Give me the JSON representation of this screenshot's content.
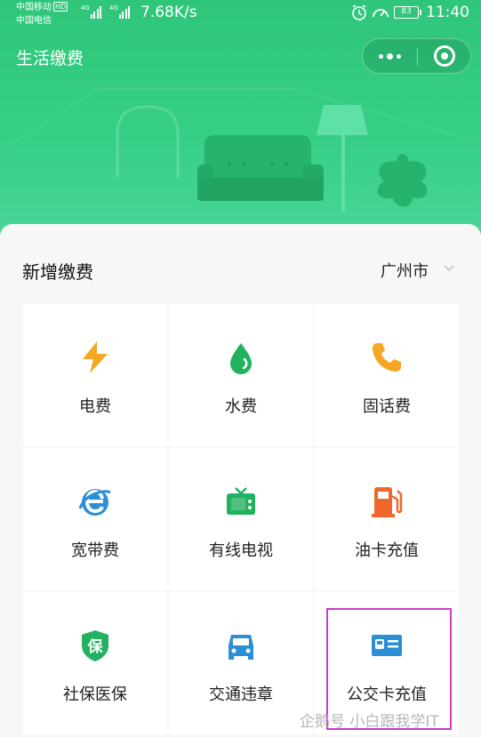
{
  "status_bar": {
    "carrier1": "中国移动",
    "carrier1_badge": "HD",
    "carrier2": "中国电信",
    "net_type": "4G",
    "net_speed": "7.68K/s",
    "battery": "83",
    "time": "11:40"
  },
  "header": {
    "title": "生活缴费"
  },
  "section": {
    "title": "新增缴费",
    "city": "广州市"
  },
  "items": [
    {
      "label": "电费",
      "icon": "lightning-icon",
      "color": "#f5a623"
    },
    {
      "label": "水费",
      "icon": "water-drop-icon",
      "color": "#22b25f"
    },
    {
      "label": "固话费",
      "icon": "phone-icon",
      "color": "#f5a623"
    },
    {
      "label": "宽带费",
      "icon": "ie-browser-icon",
      "color": "#2b8fd6"
    },
    {
      "label": "有线电视",
      "icon": "tv-icon",
      "color": "#22b25f"
    },
    {
      "label": "油卡充值",
      "icon": "gas-pump-icon",
      "color": "#f0672b"
    },
    {
      "label": "社保医保",
      "icon": "shield-icon",
      "color": "#22b25f",
      "badge_text": "保"
    },
    {
      "label": "交通违章",
      "icon": "car-icon",
      "color": "#2b8fd6"
    },
    {
      "label": "公交卡充值",
      "icon": "bus-card-icon",
      "color": "#2b8fd6"
    }
  ],
  "watermark": "企鹅号 小白跟我学IT",
  "colors": {
    "header_green": "#36cf86",
    "highlight": "#c83ccb"
  }
}
